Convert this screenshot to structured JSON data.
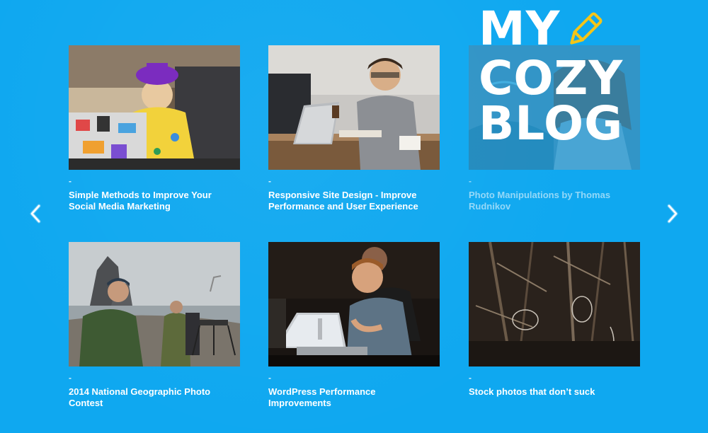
{
  "logo": {
    "line1": "MY",
    "line2": "COZY",
    "line3": "BLOG",
    "pencil_icon": "pencil-icon"
  },
  "navigation": {
    "prev_icon": "chevron-left-icon",
    "next_icon": "chevron-right-icon"
  },
  "posts": [
    {
      "dash": "-",
      "title": "Simple Methods to Improve Your Social Media Marketing"
    },
    {
      "dash": "-",
      "title": "Responsive Site Design - Improve Performance and User Experience"
    },
    {
      "dash": "-",
      "title": "Photo Manipulations by Thomas Rudnikov"
    },
    {
      "dash": "-",
      "title": "2014 National Geographic Photo Contest"
    },
    {
      "dash": "-",
      "title": "WordPress Performance Improvements"
    },
    {
      "dash": "-",
      "title": "Stock photos that don’t suck"
    }
  ],
  "colors": {
    "background": "#0fa8f0",
    "text": "#ffffff",
    "accent_pencil": "#f5c518"
  }
}
